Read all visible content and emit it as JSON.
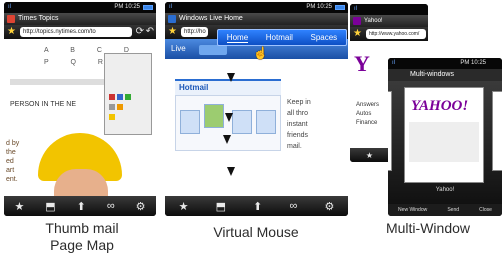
{
  "statusbar": {
    "signal": "ıl",
    "time": "PM 10:25"
  },
  "phone1": {
    "title": "Times Topics",
    "url": "http://topics.nytimes.com/to",
    "alphabet": [
      "A B C D",
      "P Q R S"
    ],
    "content_text": "PERSON IN THE NE",
    "side_text": [
      "d by",
      "the",
      "ed",
      "art",
      "ent."
    ],
    "caption_lines": [
      "Thumb mail",
      "Page Map"
    ]
  },
  "phone2": {
    "title": "Windows Live Home",
    "url": "http://ho",
    "menu_items": [
      "Home",
      "Hotmail",
      "Spaces"
    ],
    "live_label": "Live",
    "hotmail_heading": "Hotmail",
    "side_text": [
      "Keep in",
      "all thro",
      "instant",
      "friends",
      "mail."
    ],
    "caption": "Virtual Mouse"
  },
  "phone3": {
    "back_title": "Yahoo!",
    "back_url": "http://www.yahoo.com/",
    "back_links": [
      "Answers",
      "Autos",
      "Finance"
    ],
    "front_title": "Multi-windows",
    "card_label": "Yahoo!",
    "bottom_items": [
      "New Window",
      "Send",
      "Close"
    ],
    "caption": "Multi-Window"
  },
  "icons": {
    "url_star": "★",
    "refresh": "⟳",
    "back": "↶",
    "toolbar": [
      "★",
      "⬒",
      "⬆",
      "∞",
      "⚙"
    ]
  },
  "colors": {
    "accent_blue": "#2f82ff",
    "yahoo_purple": "#7b0099",
    "hard_hat": "#f2c400"
  }
}
